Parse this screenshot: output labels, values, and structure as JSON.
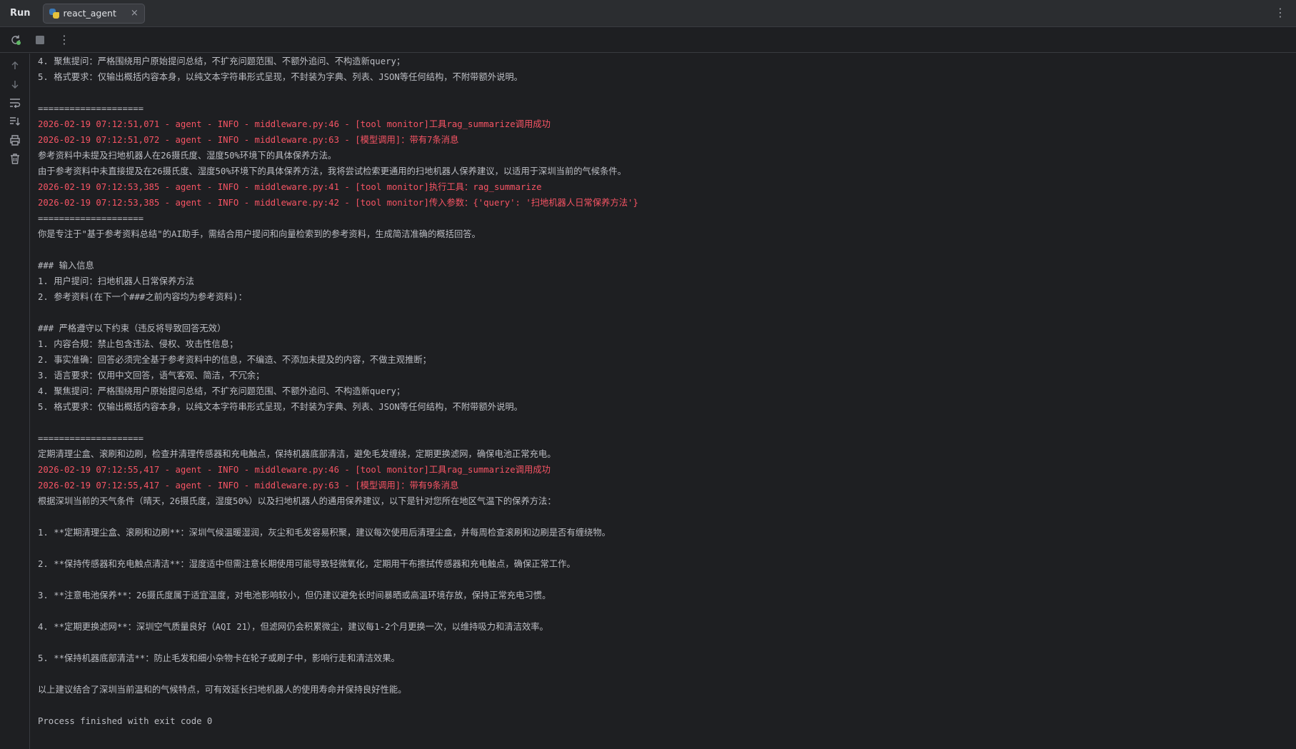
{
  "topbar": {
    "run_label": "Run",
    "tab_label": "react_agent",
    "tab_close": "×",
    "more_icon": "⋮"
  },
  "toolbar": {
    "rerun_icon": "rerun-icon",
    "stop_icon": "stop-icon",
    "more_icon": "⋮"
  },
  "colors": {
    "background": "#1e1f22",
    "panel": "#2b2d30",
    "text": "#bcbec4",
    "error_text": "#f75464",
    "rerun_green": "#5fb865"
  },
  "console": {
    "lines": [
      {
        "text": "4. 聚焦提问：严格围绕用户原始提问总结，不扩充问题范围、不额外追问、不构造新query；",
        "type": "out"
      },
      {
        "text": "5. 格式要求：仅输出概括内容本身，以纯文本字符串形式呈现，不封装为字典、列表、JSON等任何结构，不附带额外说明。",
        "type": "out"
      },
      {
        "text": "",
        "type": "out"
      },
      {
        "text": "====================",
        "type": "out"
      },
      {
        "text": "2026-02-19 07:12:51,071 - agent - INFO - middleware.py:46 - [tool monitor]工具rag_summarize调用成功",
        "type": "err"
      },
      {
        "text": "2026-02-19 07:12:51,072 - agent - INFO - middleware.py:63 - [模型调用]：带有7条消息",
        "type": "err"
      },
      {
        "text": "参考资料中未提及扫地机器人在26摄氏度、湿度50%环境下的具体保养方法。",
        "type": "out"
      },
      {
        "text": "由于参考资料中未直接提及在26摄氏度、湿度50%环境下的具体保养方法，我将尝试检索更通用的扫地机器人保养建议，以适用于深圳当前的气候条件。",
        "type": "out"
      },
      {
        "text": "2026-02-19 07:12:53,385 - agent - INFO - middleware.py:41 - [tool monitor]执行工具：rag_summarize",
        "type": "err"
      },
      {
        "text": "2026-02-19 07:12:53,385 - agent - INFO - middleware.py:42 - [tool monitor]传入参数：{'query': '扫地机器人日常保养方法'}",
        "type": "err"
      },
      {
        "text": "====================",
        "type": "out"
      },
      {
        "text": "你是专注于\"基于参考资料总结\"的AI助手，需结合用户提问和向量检索到的参考资料，生成简洁准确的概括回答。",
        "type": "out"
      },
      {
        "text": "",
        "type": "out"
      },
      {
        "text": "### 输入信息",
        "type": "out"
      },
      {
        "text": "1. 用户提问：扫地机器人日常保养方法",
        "type": "out"
      },
      {
        "text": "2. 参考资料(在下一个###之前内容均为参考资料)：",
        "type": "out"
      },
      {
        "text": "",
        "type": "out"
      },
      {
        "text": "### 严格遵守以下约束（违反将导致回答无效）",
        "type": "out"
      },
      {
        "text": "1. 内容合规：禁止包含违法、侵权、攻击性信息；",
        "type": "out"
      },
      {
        "text": "2. 事实准确：回答必须完全基于参考资料中的信息，不编造、不添加未提及的内容，不做主观推断；",
        "type": "out"
      },
      {
        "text": "3. 语言要求：仅用中文回答，语气客观、简洁，不冗余；",
        "type": "out"
      },
      {
        "text": "4. 聚焦提问：严格围绕用户原始提问总结，不扩充问题范围、不额外追问、不构造新query；",
        "type": "out"
      },
      {
        "text": "5. 格式要求：仅输出概括内容本身，以纯文本字符串形式呈现，不封装为字典、列表、JSON等任何结构，不附带额外说明。",
        "type": "out"
      },
      {
        "text": "",
        "type": "out"
      },
      {
        "text": "====================",
        "type": "out"
      },
      {
        "text": "定期清理尘盒、滚刷和边刷，检查并清理传感器和充电触点，保持机器底部清洁，避免毛发缠绕，定期更换滤网，确保电池正常充电。",
        "type": "out"
      },
      {
        "text": "2026-02-19 07:12:55,417 - agent - INFO - middleware.py:46 - [tool monitor]工具rag_summarize调用成功",
        "type": "err"
      },
      {
        "text": "2026-02-19 07:12:55,417 - agent - INFO - middleware.py:63 - [模型调用]：带有9条消息",
        "type": "err"
      },
      {
        "text": "根据深圳当前的天气条件（晴天，26摄氏度，湿度50%）以及扫地机器人的通用保养建议，以下是针对您所在地区气温下的保养方法：",
        "type": "out"
      },
      {
        "text": "",
        "type": "out"
      },
      {
        "text": "1. **定期清理尘盒、滚刷和边刷**：深圳气候温暖湿润，灰尘和毛发容易积聚，建议每次使用后清理尘盒，并每周检查滚刷和边刷是否有缠绕物。",
        "type": "out"
      },
      {
        "text": "",
        "type": "out"
      },
      {
        "text": "2. **保持传感器和充电触点清洁**：湿度适中但需注意长期使用可能导致轻微氧化，定期用干布擦拭传感器和充电触点，确保正常工作。",
        "type": "out"
      },
      {
        "text": "",
        "type": "out"
      },
      {
        "text": "3. **注意电池保养**：26摄氏度属于适宜温度，对电池影响较小，但仍建议避免长时间暴晒或高温环境存放，保持正常充电习惯。",
        "type": "out"
      },
      {
        "text": "",
        "type": "out"
      },
      {
        "text": "4. **定期更换滤网**：深圳空气质量良好（AQI 21），但滤网仍会积累微尘，建议每1-2个月更换一次，以维持吸力和清洁效率。",
        "type": "out"
      },
      {
        "text": "",
        "type": "out"
      },
      {
        "text": "5. **保持机器底部清洁**：防止毛发和细小杂物卡在轮子或刷子中，影响行走和清洁效果。",
        "type": "out"
      },
      {
        "text": "",
        "type": "out"
      },
      {
        "text": "以上建议结合了深圳当前温和的气候特点，可有效延长扫地机器人的使用寿命并保持良好性能。",
        "type": "out"
      },
      {
        "text": "",
        "type": "out"
      },
      {
        "text": "Process finished with exit code 0",
        "type": "out"
      }
    ]
  }
}
